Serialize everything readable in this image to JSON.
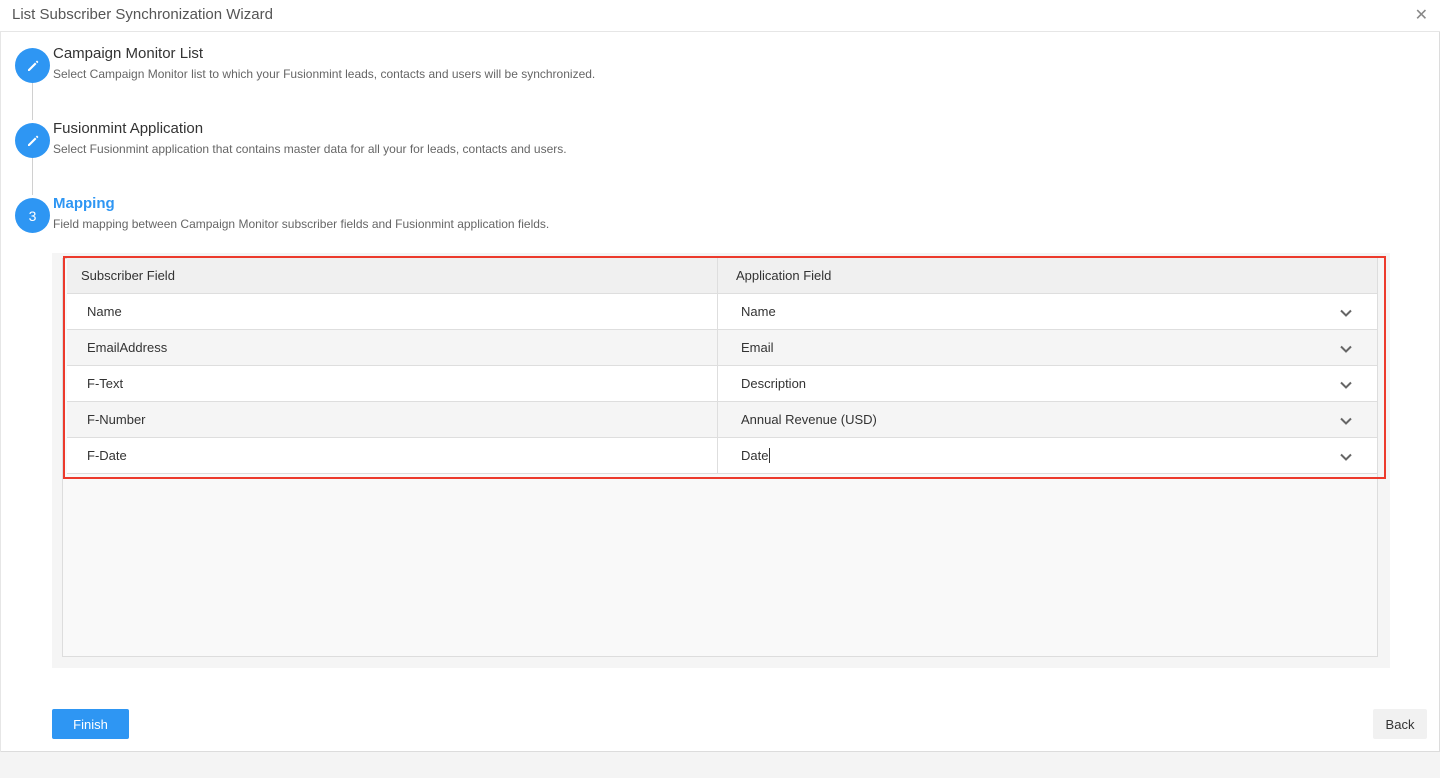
{
  "window": {
    "title": "List Subscriber Synchronization Wizard",
    "close_icon": "close-icon"
  },
  "steps": [
    {
      "marker": "pencil-icon",
      "title": "Campaign Monitor List",
      "description": "Select Campaign Monitor list to which your Fusionmint leads, contacts and users will be synchronized."
    },
    {
      "marker": "pencil-icon",
      "title": "Fusionmint Application",
      "description": "Select Fusionmint application that contains master data for all your for leads, contacts and users."
    },
    {
      "number": "3",
      "title": "Mapping",
      "description": "Field mapping between Campaign Monitor subscriber fields and Fusionmint application fields."
    }
  ],
  "mapping": {
    "columns": [
      "Subscriber Field",
      "Application Field"
    ],
    "rows": [
      {
        "subscriber": "Name",
        "application": "Name"
      },
      {
        "subscriber": "EmailAddress",
        "application": "Email"
      },
      {
        "subscriber": "F-Text",
        "application": "Description"
      },
      {
        "subscriber": "F-Number",
        "application": "Annual Revenue (USD)"
      },
      {
        "subscriber": "F-Date",
        "application": "Date"
      }
    ]
  },
  "buttons": {
    "finish": "Finish",
    "back": "Back"
  },
  "colors": {
    "accent": "#2e96f3",
    "highlight": "#ec3a2c"
  }
}
